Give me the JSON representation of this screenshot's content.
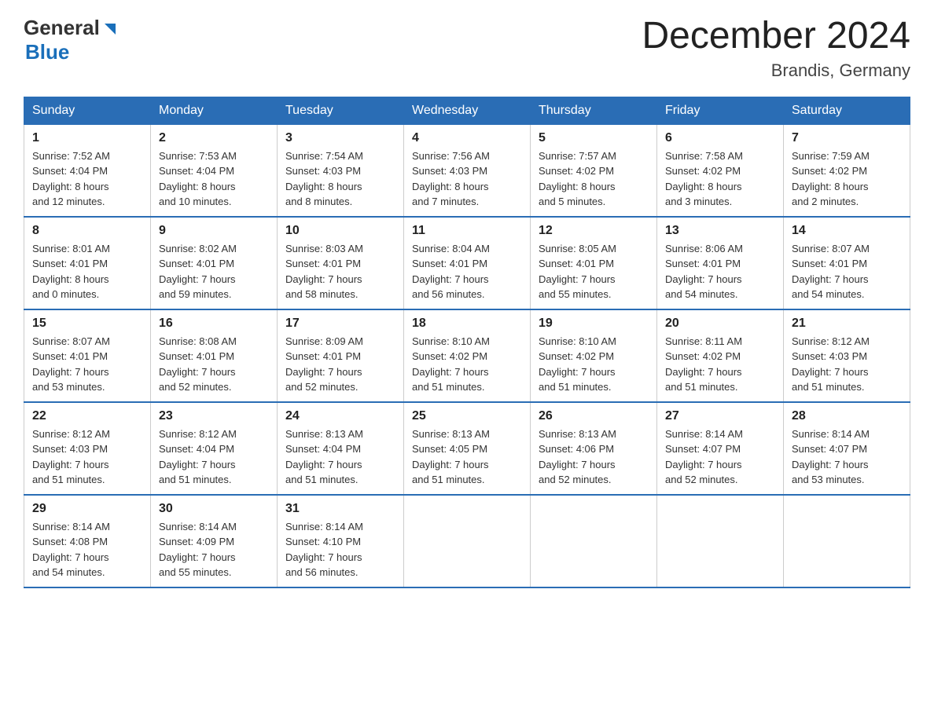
{
  "header": {
    "logo_general": "General",
    "logo_blue": "Blue",
    "month_title": "December 2024",
    "location": "Brandis, Germany"
  },
  "calendar": {
    "days_of_week": [
      "Sunday",
      "Monday",
      "Tuesday",
      "Wednesday",
      "Thursday",
      "Friday",
      "Saturday"
    ],
    "weeks": [
      [
        {
          "day": "1",
          "info": "Sunrise: 7:52 AM\nSunset: 4:04 PM\nDaylight: 8 hours\nand 12 minutes."
        },
        {
          "day": "2",
          "info": "Sunrise: 7:53 AM\nSunset: 4:04 PM\nDaylight: 8 hours\nand 10 minutes."
        },
        {
          "day": "3",
          "info": "Sunrise: 7:54 AM\nSunset: 4:03 PM\nDaylight: 8 hours\nand 8 minutes."
        },
        {
          "day": "4",
          "info": "Sunrise: 7:56 AM\nSunset: 4:03 PM\nDaylight: 8 hours\nand 7 minutes."
        },
        {
          "day": "5",
          "info": "Sunrise: 7:57 AM\nSunset: 4:02 PM\nDaylight: 8 hours\nand 5 minutes."
        },
        {
          "day": "6",
          "info": "Sunrise: 7:58 AM\nSunset: 4:02 PM\nDaylight: 8 hours\nand 3 minutes."
        },
        {
          "day": "7",
          "info": "Sunrise: 7:59 AM\nSunset: 4:02 PM\nDaylight: 8 hours\nand 2 minutes."
        }
      ],
      [
        {
          "day": "8",
          "info": "Sunrise: 8:01 AM\nSunset: 4:01 PM\nDaylight: 8 hours\nand 0 minutes."
        },
        {
          "day": "9",
          "info": "Sunrise: 8:02 AM\nSunset: 4:01 PM\nDaylight: 7 hours\nand 59 minutes."
        },
        {
          "day": "10",
          "info": "Sunrise: 8:03 AM\nSunset: 4:01 PM\nDaylight: 7 hours\nand 58 minutes."
        },
        {
          "day": "11",
          "info": "Sunrise: 8:04 AM\nSunset: 4:01 PM\nDaylight: 7 hours\nand 56 minutes."
        },
        {
          "day": "12",
          "info": "Sunrise: 8:05 AM\nSunset: 4:01 PM\nDaylight: 7 hours\nand 55 minutes."
        },
        {
          "day": "13",
          "info": "Sunrise: 8:06 AM\nSunset: 4:01 PM\nDaylight: 7 hours\nand 54 minutes."
        },
        {
          "day": "14",
          "info": "Sunrise: 8:07 AM\nSunset: 4:01 PM\nDaylight: 7 hours\nand 54 minutes."
        }
      ],
      [
        {
          "day": "15",
          "info": "Sunrise: 8:07 AM\nSunset: 4:01 PM\nDaylight: 7 hours\nand 53 minutes."
        },
        {
          "day": "16",
          "info": "Sunrise: 8:08 AM\nSunset: 4:01 PM\nDaylight: 7 hours\nand 52 minutes."
        },
        {
          "day": "17",
          "info": "Sunrise: 8:09 AM\nSunset: 4:01 PM\nDaylight: 7 hours\nand 52 minutes."
        },
        {
          "day": "18",
          "info": "Sunrise: 8:10 AM\nSunset: 4:02 PM\nDaylight: 7 hours\nand 51 minutes."
        },
        {
          "day": "19",
          "info": "Sunrise: 8:10 AM\nSunset: 4:02 PM\nDaylight: 7 hours\nand 51 minutes."
        },
        {
          "day": "20",
          "info": "Sunrise: 8:11 AM\nSunset: 4:02 PM\nDaylight: 7 hours\nand 51 minutes."
        },
        {
          "day": "21",
          "info": "Sunrise: 8:12 AM\nSunset: 4:03 PM\nDaylight: 7 hours\nand 51 minutes."
        }
      ],
      [
        {
          "day": "22",
          "info": "Sunrise: 8:12 AM\nSunset: 4:03 PM\nDaylight: 7 hours\nand 51 minutes."
        },
        {
          "day": "23",
          "info": "Sunrise: 8:12 AM\nSunset: 4:04 PM\nDaylight: 7 hours\nand 51 minutes."
        },
        {
          "day": "24",
          "info": "Sunrise: 8:13 AM\nSunset: 4:04 PM\nDaylight: 7 hours\nand 51 minutes."
        },
        {
          "day": "25",
          "info": "Sunrise: 8:13 AM\nSunset: 4:05 PM\nDaylight: 7 hours\nand 51 minutes."
        },
        {
          "day": "26",
          "info": "Sunrise: 8:13 AM\nSunset: 4:06 PM\nDaylight: 7 hours\nand 52 minutes."
        },
        {
          "day": "27",
          "info": "Sunrise: 8:14 AM\nSunset: 4:07 PM\nDaylight: 7 hours\nand 52 minutes."
        },
        {
          "day": "28",
          "info": "Sunrise: 8:14 AM\nSunset: 4:07 PM\nDaylight: 7 hours\nand 53 minutes."
        }
      ],
      [
        {
          "day": "29",
          "info": "Sunrise: 8:14 AM\nSunset: 4:08 PM\nDaylight: 7 hours\nand 54 minutes."
        },
        {
          "day": "30",
          "info": "Sunrise: 8:14 AM\nSunset: 4:09 PM\nDaylight: 7 hours\nand 55 minutes."
        },
        {
          "day": "31",
          "info": "Sunrise: 8:14 AM\nSunset: 4:10 PM\nDaylight: 7 hours\nand 56 minutes."
        },
        {
          "day": "",
          "info": ""
        },
        {
          "day": "",
          "info": ""
        },
        {
          "day": "",
          "info": ""
        },
        {
          "day": "",
          "info": ""
        }
      ]
    ]
  }
}
